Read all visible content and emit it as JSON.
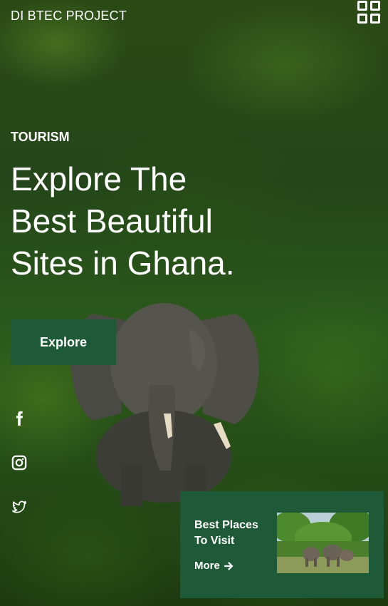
{
  "header": {
    "brand": "DI BTEC PROJECT",
    "menu_icon": "grid-menu-icon"
  },
  "hero": {
    "kicker": "TOURISM",
    "headline_line1": "Explore The",
    "headline_line2": "Best Beautiful",
    "headline_line3": "Sites in Ghana.",
    "cta_label": "Explore"
  },
  "social": [
    {
      "name": "facebook",
      "icon": "facebook-icon"
    },
    {
      "name": "instagram",
      "icon": "instagram-icon"
    },
    {
      "name": "twitter",
      "icon": "twitter-icon"
    }
  ],
  "card": {
    "title": "Best Places To Visit",
    "more_label": "More",
    "more_icon": "arrow-right-icon"
  },
  "colors": {
    "accent": "#1e5a37",
    "text": "#ffffff"
  }
}
